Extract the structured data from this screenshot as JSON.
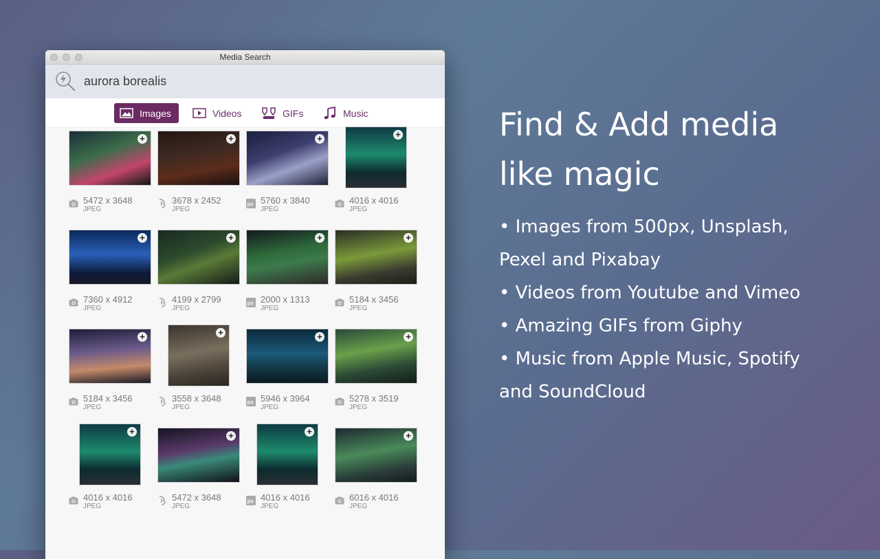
{
  "window": {
    "title": "Media Search"
  },
  "search": {
    "query": "aurora borealis"
  },
  "tabs": [
    {
      "label": "Images",
      "icon": "image-icon"
    },
    {
      "label": "Videos",
      "icon": "play-icon"
    },
    {
      "label": "GIFs",
      "icon": "gif-icon"
    },
    {
      "label": "Music",
      "icon": "music-note-icon"
    }
  ],
  "results": [
    {
      "dims": "5472 x 3648",
      "format": "JPEG",
      "source_icon": "camera-icon"
    },
    {
      "dims": "3678 x 2452",
      "format": "JPEG",
      "source_icon": "unsplash-icon"
    },
    {
      "dims": "5760 x 3840",
      "format": "JPEG",
      "source_icon": "pixabay-icon"
    },
    {
      "dims": "4016 x 4016",
      "format": "JPEG",
      "source_icon": "camera-icon"
    },
    {
      "dims": "7360 x 4912",
      "format": "JPEG",
      "source_icon": "camera-icon"
    },
    {
      "dims": "4199 x 2799",
      "format": "JPEG",
      "source_icon": "unsplash-icon"
    },
    {
      "dims": "2000 x 1313",
      "format": "JPEG",
      "source_icon": "pixabay-icon"
    },
    {
      "dims": "5184 x 3456",
      "format": "JPEG",
      "source_icon": "camera-icon"
    },
    {
      "dims": "5184 x 3456",
      "format": "JPEG",
      "source_icon": "camera-icon"
    },
    {
      "dims": "3558 x 3648",
      "format": "JPEG",
      "source_icon": "unsplash-icon"
    },
    {
      "dims": "5946 x 3964",
      "format": "JPEG",
      "source_icon": "pixabay-icon"
    },
    {
      "dims": "5278 x 3519",
      "format": "JPEG",
      "source_icon": "camera-icon"
    },
    {
      "dims": "4016 x 4016",
      "format": "JPEG",
      "source_icon": "camera-icon"
    },
    {
      "dims": "5472 x 3648",
      "format": "JPEG",
      "source_icon": "unsplash-icon"
    },
    {
      "dims": "4016 x 4016",
      "format": "JPEG",
      "source_icon": "pixabay-icon"
    },
    {
      "dims": "6016 x 4016",
      "format": "JPEG",
      "source_icon": "camera-icon"
    }
  ],
  "promo": {
    "headline_1": "Find & Add media",
    "headline_2": "like magic",
    "bullets": [
      "•  Images from 500px, Unsplash,",
      "Pexel and Pixabay",
      "•  Videos from Youtube and Vimeo",
      "•  Amazing GIFs from Giphy",
      "•  Music from Apple Music, Spotify",
      "and SoundCloud"
    ]
  },
  "colors": {
    "accent": "#6b2a64",
    "background": "#5f7a98"
  }
}
